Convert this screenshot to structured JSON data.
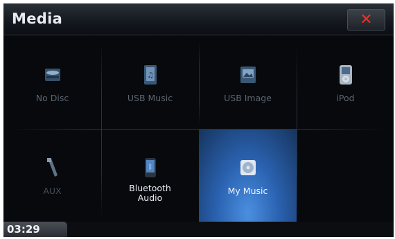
{
  "header": {
    "title": "Media",
    "close_icon": "close-icon",
    "close_color": "#ff2a1f"
  },
  "tiles": [
    {
      "label": "No Disc",
      "icon": "disc-icon",
      "enabled": false
    },
    {
      "label": "USB Music",
      "icon": "usb-music-icon",
      "enabled": false
    },
    {
      "label": "USB Image",
      "icon": "usb-image-icon",
      "enabled": false
    },
    {
      "label": "iPod",
      "icon": "ipod-icon",
      "enabled": false
    },
    {
      "label": "AUX",
      "icon": "aux-cable-icon",
      "enabled": false
    },
    {
      "label": "Bluetooth Audio",
      "icon": "bluetooth-phone-icon",
      "enabled": true
    },
    {
      "label": "My Music",
      "icon": "cd-icon",
      "enabled": true,
      "selected": true
    }
  ],
  "status": {
    "time": "03:29"
  },
  "colors": {
    "accent": "#2a62b0",
    "background": "#07090c"
  }
}
